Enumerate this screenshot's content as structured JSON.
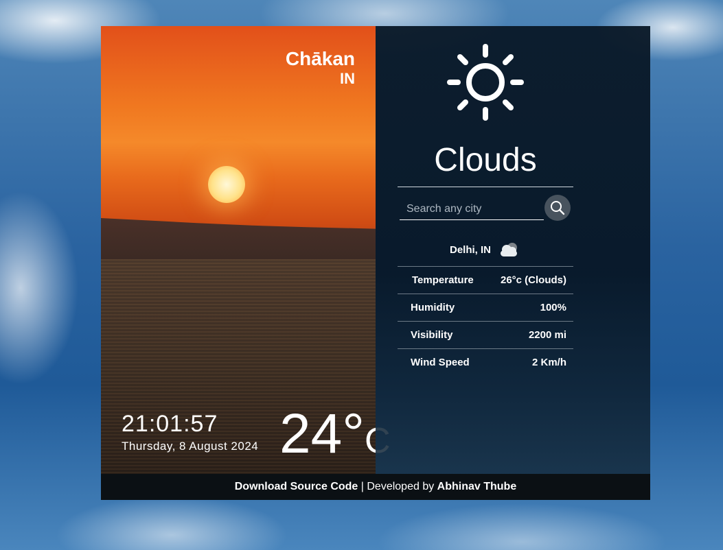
{
  "location": {
    "city": "Chākan",
    "country": "IN"
  },
  "clock": {
    "time": "21:01:57",
    "date": "Thursday, 8 August 2024"
  },
  "current": {
    "temperature": "24°",
    "unit": "C",
    "condition": "Clouds",
    "icon": "sun-icon"
  },
  "search": {
    "placeholder": "Search any city",
    "value": "",
    "button_icon": "search-icon"
  },
  "searched_city": {
    "label": "Delhi, IN",
    "icon": "cloud-icon"
  },
  "details": [
    {
      "label": "Temperature",
      "value": "26°c (Clouds)"
    },
    {
      "label": "Humidity",
      "value": "100%"
    },
    {
      "label": "Visibility",
      "value": "2200 mi"
    },
    {
      "label": "Wind Speed",
      "value": "2 Km/h"
    }
  ],
  "footer": {
    "link_text": "Download Source Code",
    "separator": " | Developed by ",
    "author": "Abhinav Thube"
  },
  "colors": {
    "panel_dark": "#061422",
    "footer_bg": "#0b1014",
    "search_button": "#48535e"
  }
}
